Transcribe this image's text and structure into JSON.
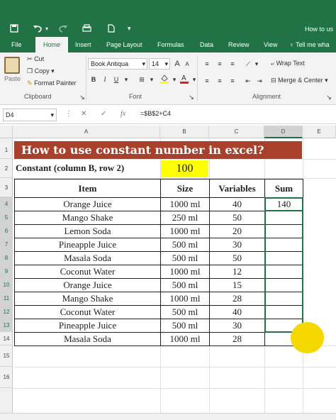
{
  "titlebar": {
    "title": "How to us",
    "save_icon": "save-icon",
    "undo_icon": "undo-icon",
    "redo_icon": "redo-icon",
    "print_icon": "print-icon",
    "new_icon": "new-file-icon"
  },
  "tabs": [
    "File",
    "Home",
    "Insert",
    "Page Layout",
    "Formulas",
    "Data",
    "Review",
    "View"
  ],
  "tell_me": "Tell me wha",
  "ribbon": {
    "clipboard": {
      "paste": "Paste",
      "cut": "Cut",
      "copy": "Copy",
      "format_painter": "Format Painter",
      "group_label": "Clipboard"
    },
    "font": {
      "font_name": "Book Antiqua",
      "font_size": "14",
      "bold": "B",
      "italic": "I",
      "underline": "U",
      "group_label": "Font"
    },
    "alignment": {
      "wrap_text": "Wrap Text",
      "merge_center": "Merge & Center",
      "group_label": "Alignment"
    }
  },
  "formula_bar": {
    "name_box": "D4",
    "formula": "=$B$2+C4"
  },
  "columns": [
    "A",
    "B",
    "C",
    "D",
    "E"
  ],
  "rows": [
    "1",
    "2",
    "3",
    "4",
    "5",
    "6",
    "7",
    "8",
    "9",
    "10",
    "11",
    "12",
    "13",
    "14",
    "15",
    "16"
  ],
  "sheet": {
    "banner": "How to use constant number in excel?",
    "constant_label": "Constant (column B, row 2)",
    "constant_value": "100",
    "headers": [
      "Item",
      "Size",
      "Variables",
      "Sum"
    ],
    "table": [
      [
        "Orange Juice",
        "1000 ml",
        "40",
        "140"
      ],
      [
        "Mango Shake",
        "250 ml",
        "50",
        ""
      ],
      [
        "Lemon Soda",
        "1000 ml",
        "20",
        ""
      ],
      [
        "Pineapple Juice",
        "500 ml",
        "30",
        ""
      ],
      [
        "Masala Soda",
        "500 ml",
        "50",
        ""
      ],
      [
        "Coconut Water",
        "1000 ml",
        "12",
        ""
      ],
      [
        "Orange Juice",
        "500 ml",
        "15",
        ""
      ],
      [
        "Mango Shake",
        "1000 ml",
        "28",
        ""
      ],
      [
        "Coconut Water",
        "500 ml",
        "40",
        ""
      ],
      [
        "Pineapple Juice",
        "500 ml",
        "30",
        ""
      ],
      [
        "Masala Soda",
        "1000 ml",
        "28",
        ""
      ]
    ]
  },
  "colors": {
    "excel_green": "#217346",
    "banner_red": "#a8402c",
    "highlight_yellow": "#ffff00",
    "cursor_yellow": "#f4d800"
  }
}
